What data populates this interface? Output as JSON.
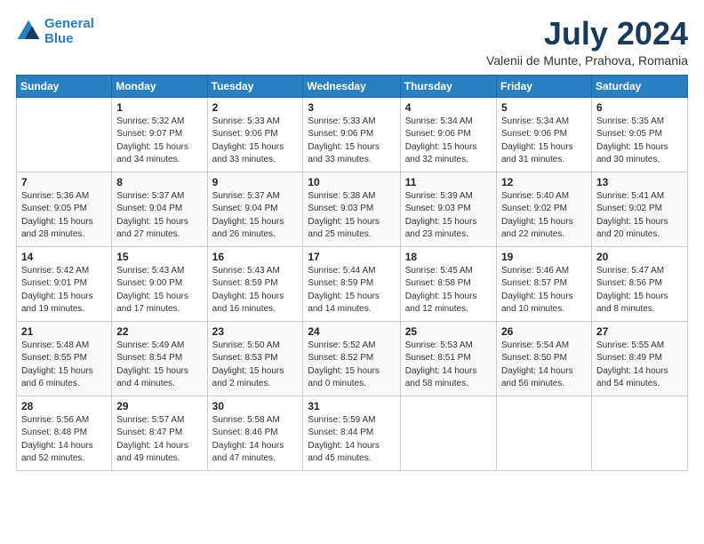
{
  "header": {
    "logo_line1": "General",
    "logo_line2": "Blue",
    "month_year": "July 2024",
    "location": "Valenii de Munte, Prahova, Romania"
  },
  "days_of_week": [
    "Sunday",
    "Monday",
    "Tuesday",
    "Wednesday",
    "Thursday",
    "Friday",
    "Saturday"
  ],
  "weeks": [
    [
      {
        "day": "",
        "info": ""
      },
      {
        "day": "1",
        "info": "Sunrise: 5:32 AM\nSunset: 9:07 PM\nDaylight: 15 hours\nand 34 minutes."
      },
      {
        "day": "2",
        "info": "Sunrise: 5:33 AM\nSunset: 9:06 PM\nDaylight: 15 hours\nand 33 minutes."
      },
      {
        "day": "3",
        "info": "Sunrise: 5:33 AM\nSunset: 9:06 PM\nDaylight: 15 hours\nand 33 minutes."
      },
      {
        "day": "4",
        "info": "Sunrise: 5:34 AM\nSunset: 9:06 PM\nDaylight: 15 hours\nand 32 minutes."
      },
      {
        "day": "5",
        "info": "Sunrise: 5:34 AM\nSunset: 9:06 PM\nDaylight: 15 hours\nand 31 minutes."
      },
      {
        "day": "6",
        "info": "Sunrise: 5:35 AM\nSunset: 9:05 PM\nDaylight: 15 hours\nand 30 minutes."
      }
    ],
    [
      {
        "day": "7",
        "info": "Sunrise: 5:36 AM\nSunset: 9:05 PM\nDaylight: 15 hours\nand 28 minutes."
      },
      {
        "day": "8",
        "info": "Sunrise: 5:37 AM\nSunset: 9:04 PM\nDaylight: 15 hours\nand 27 minutes."
      },
      {
        "day": "9",
        "info": "Sunrise: 5:37 AM\nSunset: 9:04 PM\nDaylight: 15 hours\nand 26 minutes."
      },
      {
        "day": "10",
        "info": "Sunrise: 5:38 AM\nSunset: 9:03 PM\nDaylight: 15 hours\nand 25 minutes."
      },
      {
        "day": "11",
        "info": "Sunrise: 5:39 AM\nSunset: 9:03 PM\nDaylight: 15 hours\nand 23 minutes."
      },
      {
        "day": "12",
        "info": "Sunrise: 5:40 AM\nSunset: 9:02 PM\nDaylight: 15 hours\nand 22 minutes."
      },
      {
        "day": "13",
        "info": "Sunrise: 5:41 AM\nSunset: 9:02 PM\nDaylight: 15 hours\nand 20 minutes."
      }
    ],
    [
      {
        "day": "14",
        "info": "Sunrise: 5:42 AM\nSunset: 9:01 PM\nDaylight: 15 hours\nand 19 minutes."
      },
      {
        "day": "15",
        "info": "Sunrise: 5:43 AM\nSunset: 9:00 PM\nDaylight: 15 hours\nand 17 minutes."
      },
      {
        "day": "16",
        "info": "Sunrise: 5:43 AM\nSunset: 8:59 PM\nDaylight: 15 hours\nand 16 minutes."
      },
      {
        "day": "17",
        "info": "Sunrise: 5:44 AM\nSunset: 8:59 PM\nDaylight: 15 hours\nand 14 minutes."
      },
      {
        "day": "18",
        "info": "Sunrise: 5:45 AM\nSunset: 8:58 PM\nDaylight: 15 hours\nand 12 minutes."
      },
      {
        "day": "19",
        "info": "Sunrise: 5:46 AM\nSunset: 8:57 PM\nDaylight: 15 hours\nand 10 minutes."
      },
      {
        "day": "20",
        "info": "Sunrise: 5:47 AM\nSunset: 8:56 PM\nDaylight: 15 hours\nand 8 minutes."
      }
    ],
    [
      {
        "day": "21",
        "info": "Sunrise: 5:48 AM\nSunset: 8:55 PM\nDaylight: 15 hours\nand 6 minutes."
      },
      {
        "day": "22",
        "info": "Sunrise: 5:49 AM\nSunset: 8:54 PM\nDaylight: 15 hours\nand 4 minutes."
      },
      {
        "day": "23",
        "info": "Sunrise: 5:50 AM\nSunset: 8:53 PM\nDaylight: 15 hours\nand 2 minutes."
      },
      {
        "day": "24",
        "info": "Sunrise: 5:52 AM\nSunset: 8:52 PM\nDaylight: 15 hours\nand 0 minutes."
      },
      {
        "day": "25",
        "info": "Sunrise: 5:53 AM\nSunset: 8:51 PM\nDaylight: 14 hours\nand 58 minutes."
      },
      {
        "day": "26",
        "info": "Sunrise: 5:54 AM\nSunset: 8:50 PM\nDaylight: 14 hours\nand 56 minutes."
      },
      {
        "day": "27",
        "info": "Sunrise: 5:55 AM\nSunset: 8:49 PM\nDaylight: 14 hours\nand 54 minutes."
      }
    ],
    [
      {
        "day": "28",
        "info": "Sunrise: 5:56 AM\nSunset: 8:48 PM\nDaylight: 14 hours\nand 52 minutes."
      },
      {
        "day": "29",
        "info": "Sunrise: 5:57 AM\nSunset: 8:47 PM\nDaylight: 14 hours\nand 49 minutes."
      },
      {
        "day": "30",
        "info": "Sunrise: 5:58 AM\nSunset: 8:46 PM\nDaylight: 14 hours\nand 47 minutes."
      },
      {
        "day": "31",
        "info": "Sunrise: 5:59 AM\nSunset: 8:44 PM\nDaylight: 14 hours\nand 45 minutes."
      },
      {
        "day": "",
        "info": ""
      },
      {
        "day": "",
        "info": ""
      },
      {
        "day": "",
        "info": ""
      }
    ]
  ]
}
